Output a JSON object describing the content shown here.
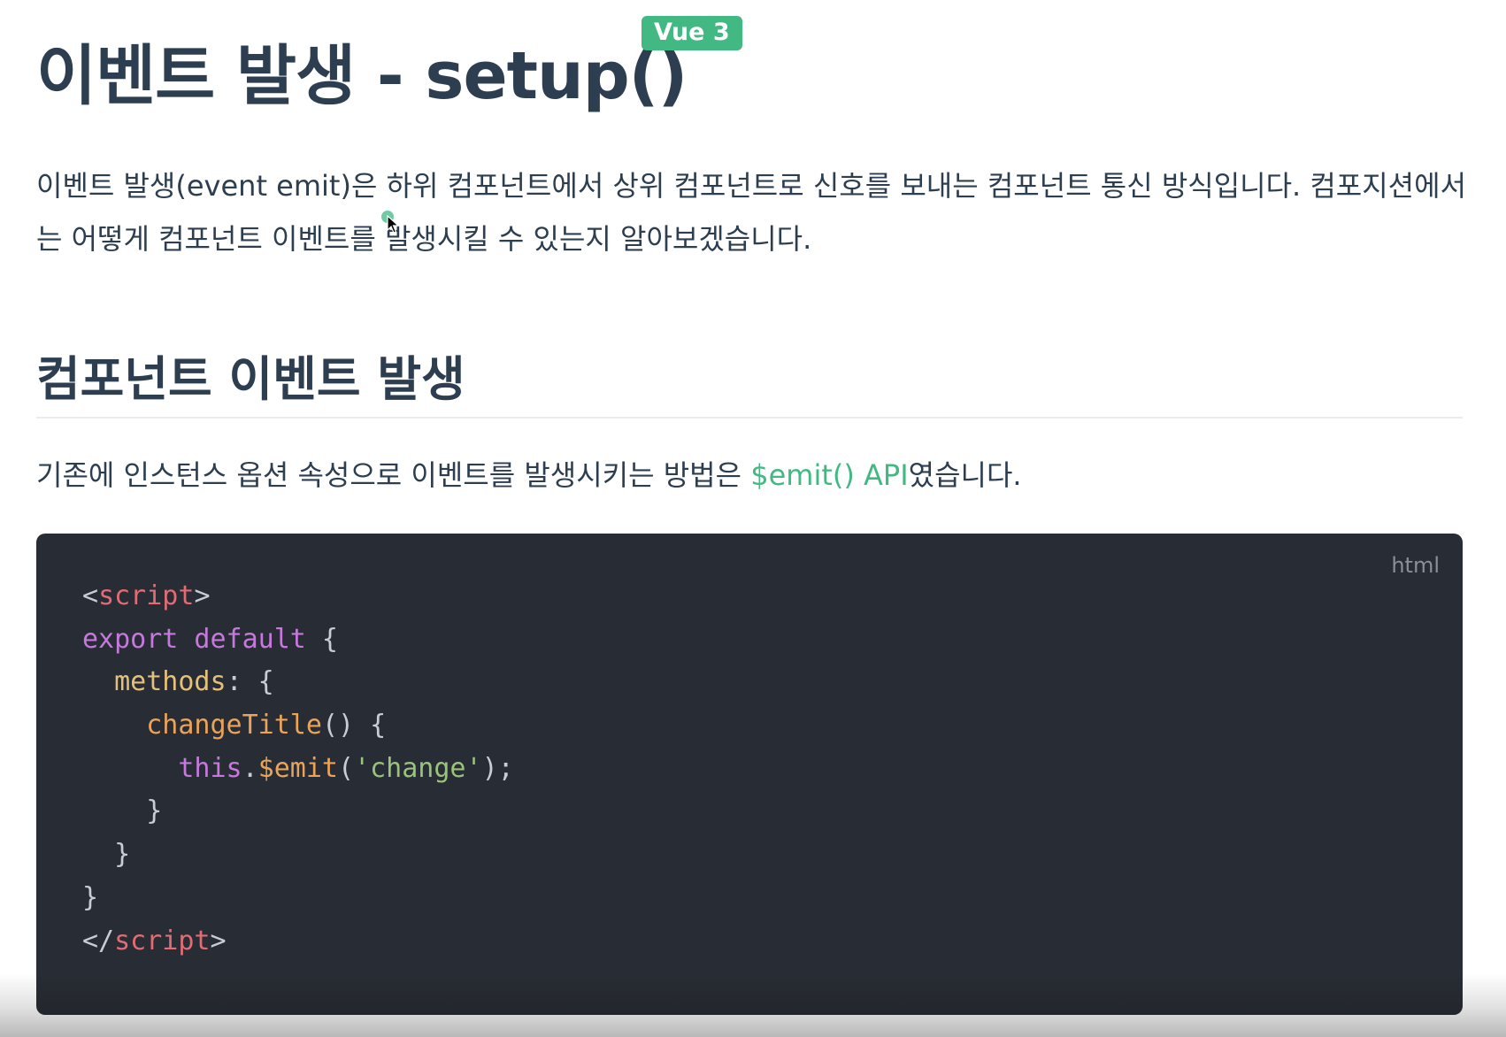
{
  "header": {
    "title": "이벤트 발생 - setup()",
    "badge": "Vue 3"
  },
  "intro": {
    "text": "이벤트 발생(event emit)은 하위 컴포넌트에서 상위 컴포넌트로 신호를 보내는 컴포넌트 통신 방식입니다. 컴포지션에서는 어떻게 컴포넌트 이벤트를 발생시킬 수 있는지 알아보겠습니다."
  },
  "section": {
    "heading": "컴포넌트 이벤트 발생",
    "desc_before": "기존에 인스턴스 옵션 속성으로 이벤트를 발생시키는 방법은 ",
    "desc_link": "$emit() API",
    "desc_after": "였습니다."
  },
  "code_block": {
    "language": "html",
    "lines": [
      [
        {
          "t": "<",
          "c": "punct"
        },
        {
          "t": "script",
          "c": "tag"
        },
        {
          "t": ">",
          "c": "punct"
        }
      ],
      [
        {
          "t": "export default",
          "c": "kw"
        },
        {
          "t": " {",
          "c": "punct"
        }
      ],
      [
        {
          "t": "  ",
          "c": "punct"
        },
        {
          "t": "methods",
          "c": "prop"
        },
        {
          "t": ": {",
          "c": "punct"
        }
      ],
      [
        {
          "t": "    ",
          "c": "punct"
        },
        {
          "t": "changeTitle",
          "c": "fn"
        },
        {
          "t": "() {",
          "c": "punct"
        }
      ],
      [
        {
          "t": "      ",
          "c": "punct"
        },
        {
          "t": "this",
          "c": "kw"
        },
        {
          "t": ".",
          "c": "punct"
        },
        {
          "t": "$emit",
          "c": "fn"
        },
        {
          "t": "(",
          "c": "punct"
        },
        {
          "t": "'change'",
          "c": "str"
        },
        {
          "t": ");",
          "c": "punct"
        }
      ],
      [
        {
          "t": "    }",
          "c": "punct"
        }
      ],
      [
        {
          "t": "  }",
          "c": "punct"
        }
      ],
      [
        {
          "t": "}",
          "c": "punct"
        }
      ],
      [
        {
          "t": "</",
          "c": "punct"
        },
        {
          "t": "script",
          "c": "tag"
        },
        {
          "t": ">",
          "c": "punct"
        }
      ]
    ]
  }
}
